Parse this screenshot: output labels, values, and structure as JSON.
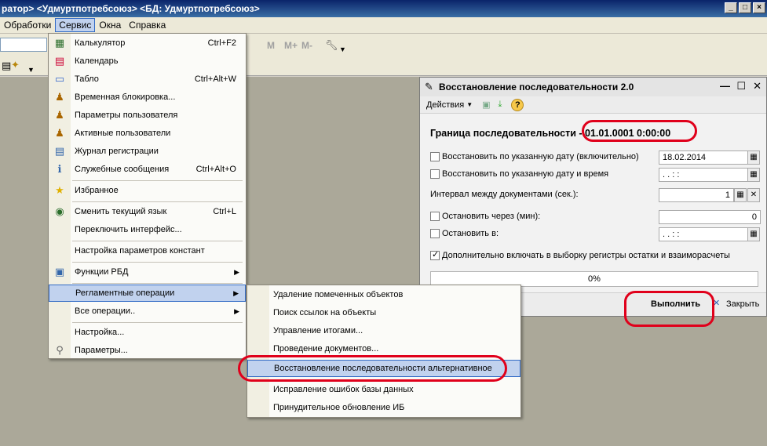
{
  "window": {
    "title": "ратор> <Удмуртпотребсоюз> <БД: Удмуртпотребсоюз>",
    "controls": [
      "_",
      "□",
      "×"
    ]
  },
  "menubar": {
    "items": [
      {
        "label": "Обработки"
      },
      {
        "label": "Сервис"
      },
      {
        "label": "Окна"
      },
      {
        "label": "Справка"
      }
    ]
  },
  "toolbar": {
    "gray_buttons": [
      "M",
      "M+",
      "M-"
    ],
    "icons": [
      "wrench-icon",
      "dropdown-arrow-icon"
    ]
  },
  "service_menu": {
    "items": [
      {
        "label": "Калькулятор",
        "shortcut": "Ctrl+F2",
        "icon": "calculator-icon"
      },
      {
        "label": "Календарь",
        "shortcut": "",
        "icon": "calendar-icon"
      },
      {
        "label": "Табло",
        "shortcut": "Ctrl+Alt+W",
        "icon": "board-icon"
      },
      {
        "label": "Временная блокировка...",
        "shortcut": "",
        "icon": "lock-user-icon"
      },
      {
        "label": "Параметры пользователя",
        "shortcut": "",
        "icon": "user-settings-icon"
      },
      {
        "label": "Активные пользователи",
        "shortcut": "",
        "icon": "users-icon"
      },
      {
        "label": "Журнал регистрации",
        "shortcut": "",
        "icon": "log-icon"
      },
      {
        "label": "Служебные сообщения",
        "shortcut": "Ctrl+Alt+O",
        "icon": "messages-icon"
      },
      {
        "label": "Избранное",
        "shortcut": "",
        "icon": "star-icon"
      },
      {
        "label": "Сменить текущий язык",
        "shortcut": "Ctrl+L",
        "icon": "language-icon"
      },
      {
        "label": "Переключить интерфейс...",
        "shortcut": "",
        "icon": ""
      },
      {
        "label": "Настройка параметров констант",
        "shortcut": "",
        "icon": ""
      },
      {
        "label": "Функции РБД",
        "shortcut": "",
        "icon": "rbd-icon"
      },
      {
        "label": "Регламентные операции",
        "shortcut": "",
        "icon": ""
      },
      {
        "label": "Все операции..",
        "shortcut": "",
        "icon": ""
      },
      {
        "label": "Настройка...",
        "shortcut": "",
        "icon": ""
      },
      {
        "label": "Параметры...",
        "shortcut": "",
        "icon": "wrench-icon"
      }
    ]
  },
  "submenu": {
    "items": [
      {
        "label": "Удаление помеченных объектов"
      },
      {
        "label": "Поиск ссылок на объекты"
      },
      {
        "label": "Управление итогами..."
      },
      {
        "label": "Проведение документов..."
      },
      {
        "label": "Восстановление последовательности альтернативное"
      },
      {
        "label": "Исправление ошибок базы данных"
      },
      {
        "label": "Принудительное обновление ИБ"
      }
    ]
  },
  "dialog": {
    "title": "Восстановление последовательности 2.0",
    "actions_label": "Действия",
    "help_label": "?",
    "heading": "Граница последовательности - 01.01.0001 0:00:00",
    "rows": {
      "restore_date_label": "Восстановить по указанную дату (включительно)",
      "restore_date_value": "18.02.2014",
      "restore_datetime_label": "Восстановить по указанную дату и время",
      "restore_datetime_value": ". .     : :",
      "interval_label": "Интервал между документами (сек.):",
      "interval_value": "1",
      "stop_after_label": "Остановить через (мин):",
      "stop_after_value": "0",
      "stop_at_label": "Остановить  в:",
      "stop_at_value": ". .     : :",
      "include_label": "Дополнительно включать в выборку регистры остатки и взаиморасчеты"
    },
    "progress": {
      "text": "0%",
      "fraction": 0
    },
    "buttons": {
      "run": "Выполнить",
      "close": "Закрыть"
    }
  }
}
